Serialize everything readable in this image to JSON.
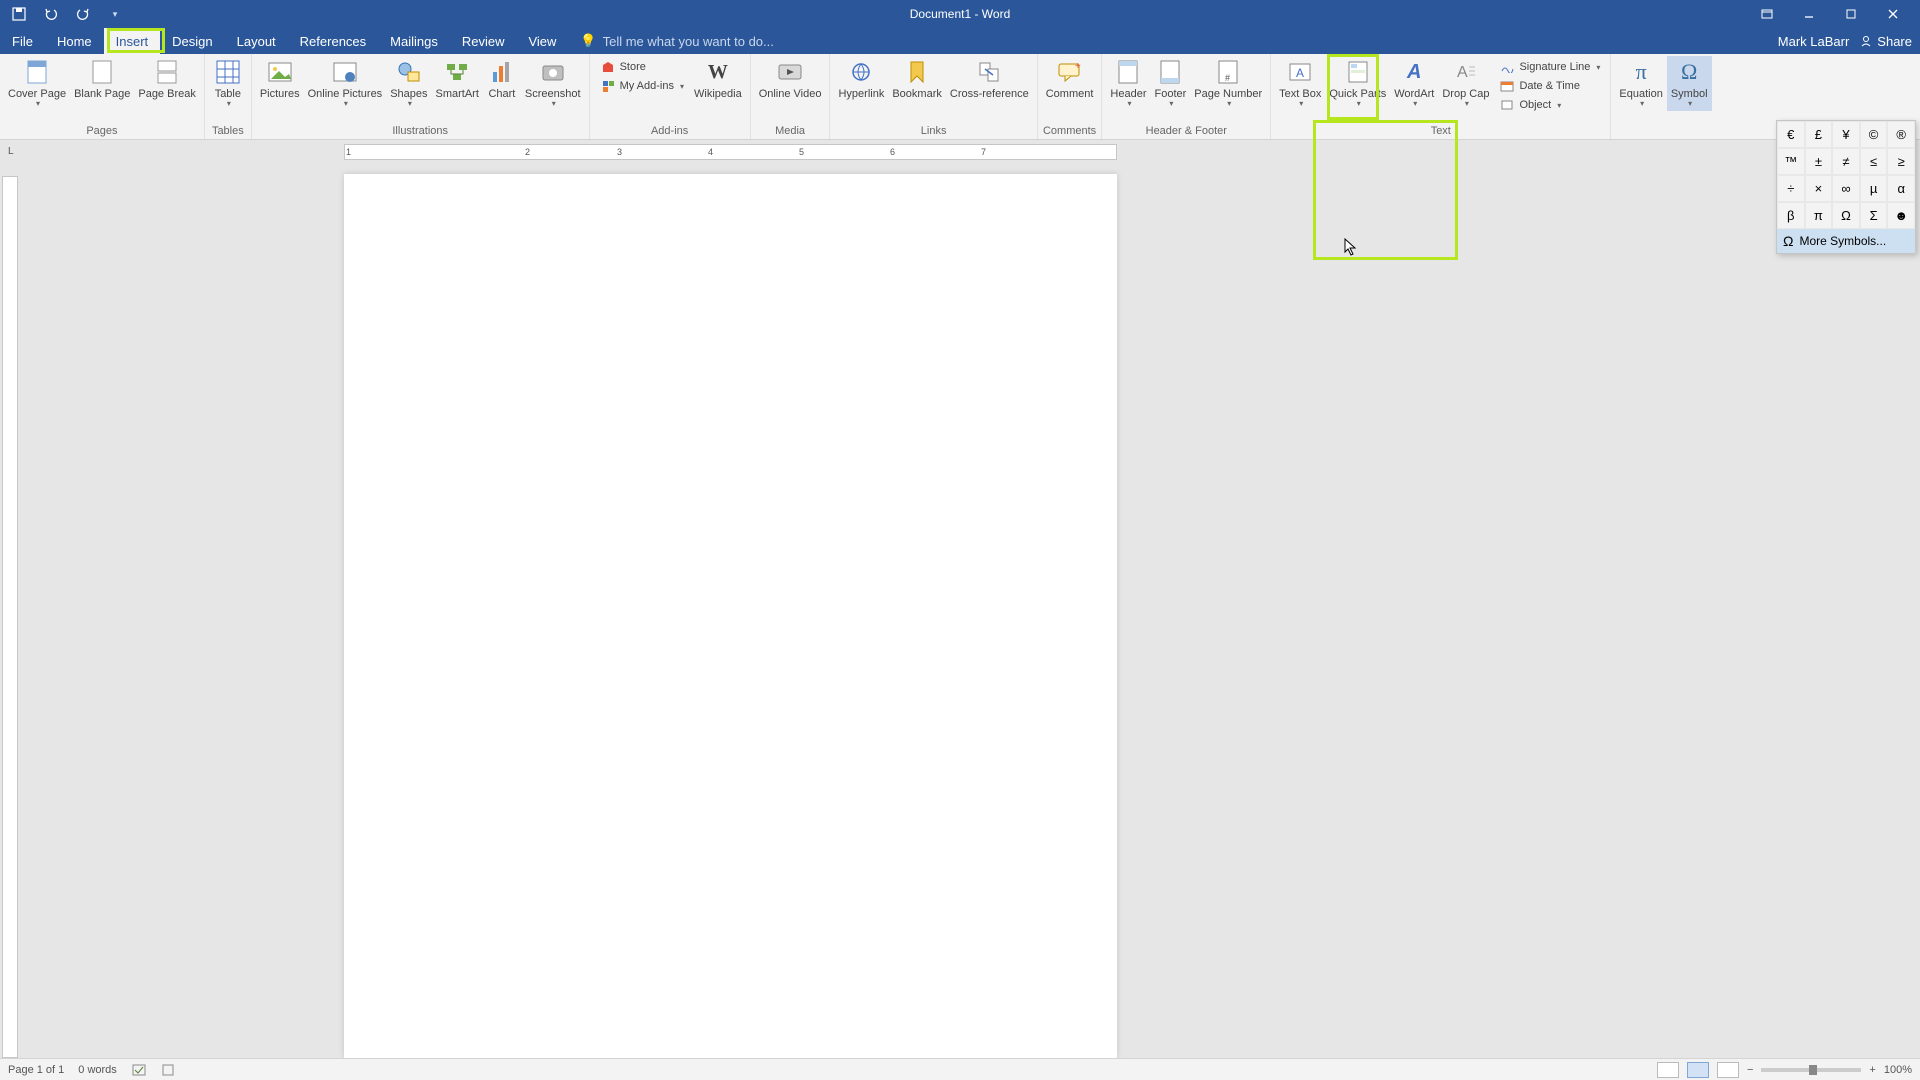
{
  "titlebar": {
    "title": "Document1 - Word"
  },
  "tabs": {
    "file": "File",
    "home": "Home",
    "insert": "Insert",
    "design": "Design",
    "layout": "Layout",
    "references": "References",
    "mailings": "Mailings",
    "review": "Review",
    "view": "View",
    "tellme_placeholder": "Tell me what you want to do...",
    "user": "Mark LaBarr",
    "share": "Share"
  },
  "ribbon": {
    "pages": {
      "cover": "Cover Page",
      "blank": "Blank Page",
      "break": "Page Break",
      "label": "Pages"
    },
    "tables": {
      "table": "Table",
      "label": "Tables"
    },
    "illustrations": {
      "pictures": "Pictures",
      "online": "Online Pictures",
      "shapes": "Shapes",
      "smartart": "SmartArt",
      "chart": "Chart",
      "screenshot": "Screenshot",
      "label": "Illustrations"
    },
    "addins": {
      "store": "Store",
      "myaddins": "My Add-ins",
      "wikipedia": "Wikipedia",
      "label": "Add-ins"
    },
    "media": {
      "video": "Online Video",
      "label": "Media"
    },
    "links": {
      "hyperlink": "Hyperlink",
      "bookmark": "Bookmark",
      "xref": "Cross-reference",
      "label": "Links"
    },
    "comments": {
      "comment": "Comment",
      "label": "Comments"
    },
    "headerfooter": {
      "header": "Header",
      "footer": "Footer",
      "pagenum": "Page Number",
      "label": "Header & Footer"
    },
    "text": {
      "textbox": "Text Box",
      "quickparts": "Quick Parts",
      "wordart": "WordArt",
      "dropcap": "Drop Cap",
      "sig": "Signature Line",
      "date": "Date & Time",
      "object": "Object",
      "label": "Text"
    },
    "symbols": {
      "equation": "Equation",
      "symbol": "Symbol"
    }
  },
  "symbol_dd": {
    "grid": [
      "€",
      "£",
      "¥",
      "©",
      "®",
      "™",
      "±",
      "≠",
      "≤",
      "≥",
      "÷",
      "×",
      "∞",
      "µ",
      "α",
      "β",
      "π",
      "Ω",
      "Σ",
      "☻"
    ],
    "more": "More Symbols..."
  },
  "ruler": {
    "marks": [
      "1",
      "2",
      "3",
      "4",
      "5",
      "6",
      "7"
    ]
  },
  "status": {
    "page": "Page 1 of 1",
    "words": "0 words",
    "zoom": "100%"
  }
}
